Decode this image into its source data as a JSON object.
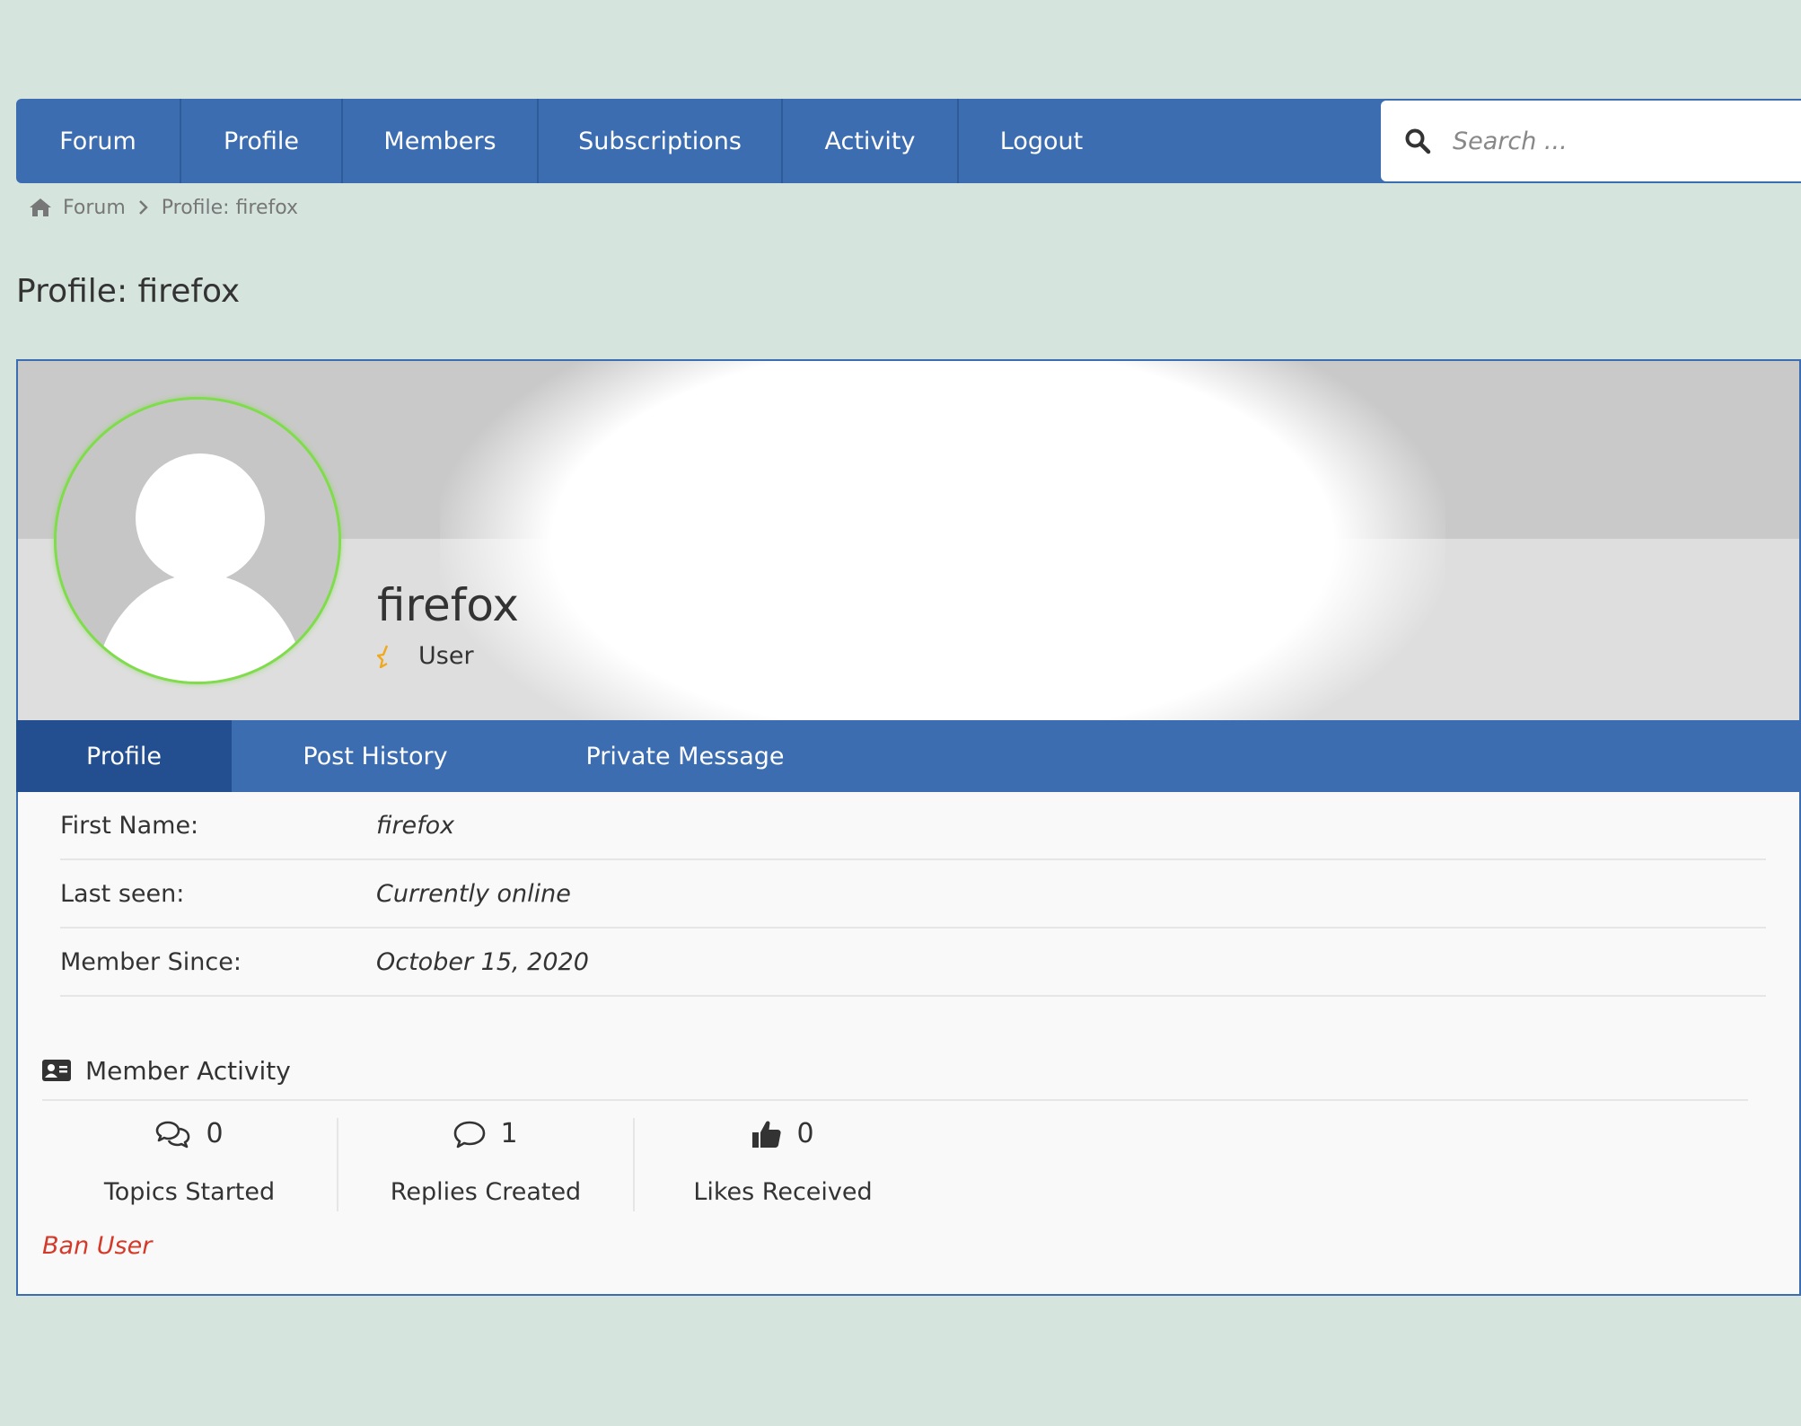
{
  "nav": {
    "items": [
      "Forum",
      "Profile",
      "Members",
      "Subscriptions",
      "Activity",
      "Logout"
    ],
    "search_placeholder": "Search ..."
  },
  "breadcrumb": {
    "home": "Forum",
    "current": "Profile: firefox"
  },
  "page_title": "Profile: firefox",
  "profile": {
    "username": "firefox",
    "role": "User",
    "tabs": [
      "Profile",
      "Post History",
      "Private Message"
    ],
    "fields": [
      {
        "label": "First Name:",
        "value": "firefox"
      },
      {
        "label": "Last seen:",
        "value": "Currently online"
      },
      {
        "label": "Member Since:",
        "value": "October 15, 2020"
      }
    ]
  },
  "activity": {
    "title": "Member Activity",
    "stats": [
      {
        "icon": "comments-icon",
        "count": "0",
        "label": "Topics Started"
      },
      {
        "icon": "comment-icon",
        "count": "1",
        "label": "Replies Created"
      },
      {
        "icon": "thumbs-up-icon",
        "count": "0",
        "label": "Likes Received"
      }
    ]
  },
  "ban_label": "Ban User",
  "colors": {
    "accent": "#3c6db0",
    "active_tab": "#234f91",
    "online_ring": "#7fdc4a",
    "danger": "#d43a2a"
  }
}
